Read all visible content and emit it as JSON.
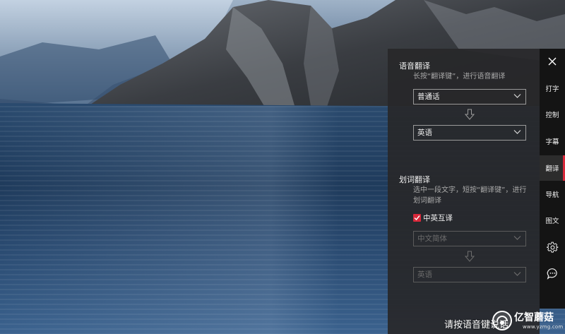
{
  "panel": {
    "voice_section": {
      "title": "语音翻译",
      "hint": "长按“翻译键”，进行语音翻译",
      "source_language": "普通话",
      "target_language": "英语"
    },
    "word_section": {
      "title": "划词翻译",
      "hint": "选中一段文字，短按“翻译键”，进行划词翻译",
      "checkbox_label": "中英互译",
      "checkbox_checked": true,
      "source_language": "中文简体",
      "target_language": "英语"
    }
  },
  "tabs": [
    {
      "label": "打字"
    },
    {
      "label": "控制"
    },
    {
      "label": "字幕"
    },
    {
      "label": "翻译",
      "active": true
    },
    {
      "label": "导航"
    },
    {
      "label": "图文"
    }
  ],
  "icons": {
    "close": "close-icon",
    "settings": "gear-icon",
    "chat": "chat-bubble-icon"
  },
  "bottom": {
    "prompt": "请按语音键说话"
  },
  "watermark": {
    "name": "亿智蘑菇",
    "url": "www.yzmg.com"
  },
  "colors": {
    "accent": "#d8283a",
    "panel_bg": "#28282a",
    "tabbar_bg": "#141414"
  }
}
